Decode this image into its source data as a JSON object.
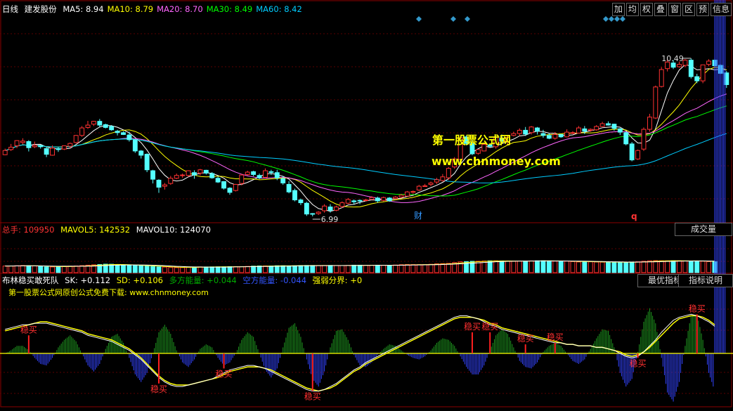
{
  "header": {
    "period": "日线",
    "stock": "建发股份",
    "ma": [
      {
        "label": "MA5: 8.94",
        "color": "#ffffff"
      },
      {
        "label": "MA10: 8.79",
        "color": "#ffff00"
      },
      {
        "label": "MA20: 8.70",
        "color": "#ff66ff"
      },
      {
        "label": "MA30: 8.49",
        "color": "#00ff00"
      },
      {
        "label": "MA60: 8.42",
        "color": "#00ccff"
      }
    ]
  },
  "toolbar": [
    "加",
    "均",
    "权",
    "叠",
    "窗",
    "区",
    "预",
    "信息"
  ],
  "volume_header": {
    "total": {
      "label": "总手: 109950",
      "color": "#ff3333"
    },
    "mavol5": {
      "label": "MAVOL5: 142532",
      "color": "#ffff00"
    },
    "mavol10": {
      "label": "MAVOL10: 124070",
      "color": "#ffffff"
    }
  },
  "volume_button": "成交量",
  "indicator_header": {
    "name": {
      "label": "布林稳买敢死队",
      "color": "#ffffff"
    },
    "sk": {
      "label": "SK: +0.112",
      "color": "#ffffff"
    },
    "sd": {
      "label": "SD: +0.106",
      "color": "#ffff00"
    },
    "long": {
      "label": "多方能量: +0.044",
      "color": "#00aa00"
    },
    "short": {
      "label": "空方能量: -0.044",
      "color": "#3355ff"
    },
    "split": {
      "label": "强弱分界: +0",
      "color": "#ffff00"
    }
  },
  "indicator_buttons": [
    "最优指标",
    "指标说明"
  ],
  "indicator_note": "第一股票公式网原创公式免费下载: www.chnmoney.com",
  "watermark": {
    "title": "第一股票公式网",
    "url": "www.chnmoney.com"
  },
  "chart_data": {
    "type": "candlestick",
    "price_range": [
      6.5,
      10.8
    ],
    "annotations": {
      "high": "10.49",
      "low": "6.99",
      "cai": "财",
      "q": "q"
    },
    "candles": [
      [
        7.84,
        7.93,
        7.97,
        7.83
      ],
      [
        7.95,
        8.0,
        8.07,
        7.92
      ],
      [
        8.03,
        8.14,
        8.15,
        7.98
      ],
      [
        8.1,
        8.13,
        8.19,
        8.06
      ],
      [
        8.12,
        7.99,
        8.15,
        7.91
      ],
      [
        8.01,
        8.04,
        8.12,
        7.98
      ],
      [
        8.04,
        8.01,
        8.05,
        7.97
      ],
      [
        7.97,
        7.85,
        8.0,
        7.79
      ],
      [
        7.83,
        7.98,
        8.04,
        7.82
      ],
      [
        7.97,
        7.95,
        8.01,
        7.9
      ],
      [
        7.96,
        8.03,
        8.04,
        7.94
      ],
      [
        8.02,
        8.08,
        8.1,
        7.98
      ],
      [
        8.1,
        8.25,
        8.26,
        8.08
      ],
      [
        8.25,
        8.41,
        8.45,
        8.22
      ],
      [
        8.42,
        8.47,
        8.56,
        8.39
      ],
      [
        8.49,
        8.55,
        8.56,
        8.45
      ],
      [
        8.55,
        8.47,
        8.6,
        8.43
      ],
      [
        8.48,
        8.42,
        8.5,
        8.4
      ],
      [
        8.44,
        8.37,
        8.47,
        8.35
      ],
      [
        8.34,
        8.31,
        8.37,
        8.25
      ],
      [
        8.31,
        8.27,
        8.34,
        8.26
      ],
      [
        8.26,
        8.16,
        8.33,
        8.12
      ],
      [
        8.16,
        7.92,
        8.17,
        7.88
      ],
      [
        7.92,
        7.83,
        7.94,
        7.76
      ],
      [
        7.85,
        7.52,
        7.87,
        7.47
      ],
      [
        7.5,
        7.32,
        7.52,
        7.23
      ],
      [
        7.3,
        7.15,
        7.32,
        7.03
      ],
      [
        7.17,
        7.2,
        7.24,
        7.1
      ],
      [
        7.23,
        7.34,
        7.39,
        7.2
      ],
      [
        7.34,
        7.4,
        7.44,
        7.32
      ],
      [
        7.4,
        7.41,
        7.44,
        7.35
      ],
      [
        7.4,
        7.5,
        7.51,
        7.37
      ],
      [
        7.46,
        7.41,
        7.51,
        7.33
      ],
      [
        7.45,
        7.52,
        7.54,
        7.4
      ],
      [
        7.51,
        7.45,
        7.52,
        7.42
      ],
      [
        7.44,
        7.35,
        7.47,
        7.33
      ],
      [
        7.34,
        7.26,
        7.38,
        7.24
      ],
      [
        7.27,
        7.13,
        7.28,
        7.1
      ],
      [
        7.13,
        7.04,
        7.15,
        6.99
      ],
      [
        7.08,
        7.21,
        7.22,
        7.06
      ],
      [
        7.23,
        7.41,
        7.43,
        7.19
      ],
      [
        7.42,
        7.47,
        7.5,
        7.4
      ],
      [
        7.48,
        7.42,
        7.5,
        7.38
      ],
      [
        7.4,
        7.35,
        7.44,
        7.32
      ],
      [
        7.36,
        7.5,
        7.55,
        7.34
      ],
      [
        7.48,
        7.47,
        7.52,
        7.41
      ],
      [
        7.46,
        7.35,
        7.52,
        7.3
      ],
      [
        7.33,
        7.24,
        7.39,
        7.2
      ],
      [
        7.21,
        7.05,
        7.28,
        7.02
      ],
      [
        7.08,
        6.88,
        7.12,
        6.85
      ],
      [
        6.88,
        6.82,
        6.91,
        6.77
      ],
      [
        6.81,
        6.58,
        6.84,
        6.54
      ],
      [
        6.59,
        6.58,
        6.6,
        6.53
      ],
      [
        6.59,
        6.62,
        6.64,
        6.56
      ],
      [
        6.65,
        6.75,
        6.79,
        6.61
      ],
      [
        6.73,
        6.66,
        6.79,
        6.61
      ],
      [
        6.66,
        6.73,
        6.76,
        6.64
      ],
      [
        6.74,
        6.82,
        6.85,
        6.71
      ],
      [
        6.81,
        6.89,
        6.92,
        6.79
      ],
      [
        6.86,
        6.84,
        6.89,
        6.79
      ],
      [
        6.87,
        6.86,
        6.89,
        6.79
      ],
      [
        6.88,
        6.88,
        6.9,
        6.85
      ],
      [
        6.89,
        6.93,
        6.96,
        6.88
      ],
      [
        6.92,
        6.86,
        6.95,
        6.82
      ],
      [
        6.87,
        6.93,
        6.95,
        6.85
      ],
      [
        6.92,
        6.86,
        6.94,
        6.84
      ],
      [
        6.91,
        6.94,
        6.96,
        6.89
      ],
      [
        6.94,
        6.98,
        7.01,
        6.92
      ],
      [
        6.96,
        7.05,
        7.07,
        6.96
      ],
      [
        7.04,
        7.06,
        7.08,
        7.01
      ],
      [
        7.09,
        7.17,
        7.2,
        7.07
      ],
      [
        7.17,
        7.18,
        7.22,
        7.16
      ],
      [
        7.21,
        7.24,
        7.27,
        7.17
      ],
      [
        7.26,
        7.31,
        7.35,
        7.22
      ],
      [
        7.29,
        7.37,
        7.43,
        7.27
      ],
      [
        7.35,
        7.55,
        7.58,
        7.31
      ],
      [
        7.58,
        7.75,
        7.79,
        7.54
      ],
      [
        7.74,
        8.2,
        8.23,
        7.72
      ],
      [
        8.22,
        8.08,
        8.25,
        8.04
      ],
      [
        8.08,
        7.86,
        8.14,
        7.83
      ],
      [
        7.87,
        7.95,
        7.95,
        7.84
      ],
      [
        7.92,
        8.06,
        8.1,
        7.91
      ],
      [
        8.05,
        8.02,
        8.06,
        8.0
      ],
      [
        8.01,
        8.21,
        8.22,
        7.97
      ],
      [
        8.19,
        8.13,
        8.27,
        8.07
      ],
      [
        8.12,
        8.21,
        8.26,
        8.06
      ],
      [
        8.25,
        8.29,
        8.33,
        8.23
      ],
      [
        8.29,
        8.36,
        8.4,
        8.24
      ],
      [
        8.36,
        8.28,
        8.43,
        8.24
      ],
      [
        8.31,
        8.43,
        8.45,
        8.27
      ],
      [
        8.41,
        8.34,
        8.43,
        8.27
      ],
      [
        8.29,
        8.25,
        8.37,
        8.2
      ],
      [
        8.25,
        8.19,
        8.3,
        8.17
      ],
      [
        8.19,
        8.27,
        8.32,
        8.16
      ],
      [
        8.27,
        8.22,
        8.28,
        8.2
      ],
      [
        8.22,
        8.32,
        8.38,
        8.21
      ],
      [
        8.31,
        8.31,
        8.34,
        8.28
      ],
      [
        8.3,
        8.41,
        8.45,
        8.29
      ],
      [
        8.39,
        8.34,
        8.45,
        8.28
      ],
      [
        8.36,
        8.38,
        8.4,
        8.33
      ],
      [
        8.37,
        8.44,
        8.47,
        8.35
      ],
      [
        8.44,
        8.5,
        8.54,
        8.43
      ],
      [
        8.5,
        8.47,
        8.55,
        8.46
      ],
      [
        8.49,
        8.4,
        8.5,
        8.35
      ],
      [
        8.39,
        8.32,
        8.41,
        8.26
      ],
      [
        8.31,
        8.07,
        8.33,
        8.04
      ],
      [
        8.07,
        7.73,
        8.11,
        7.7
      ],
      [
        7.75,
        7.93,
        7.95,
        7.73
      ],
      [
        7.96,
        8.38,
        8.42,
        7.92
      ],
      [
        8.38,
        8.64,
        8.71,
        8.33
      ],
      [
        8.62,
        9.28,
        9.31,
        8.6
      ],
      [
        9.29,
        9.65,
        9.7,
        9.27
      ],
      [
        9.67,
        9.81,
        9.87,
        9.61
      ],
      [
        9.79,
        9.7,
        9.85,
        9.66
      ],
      [
        9.71,
        9.76,
        9.82,
        9.69
      ],
      [
        9.74,
        9.85,
        9.87,
        9.7
      ],
      [
        9.85,
        9.5,
        9.89,
        9.46
      ],
      [
        9.5,
        9.41,
        9.56,
        9.36
      ],
      [
        9.41,
        9.75,
        9.75,
        9.36
      ],
      [
        9.76,
        9.83,
        9.87,
        9.72
      ],
      [
        9.85,
        9.73,
        9.89,
        9.71
      ],
      [
        9.74,
        9.57,
        9.77,
        9.55
      ],
      [
        9.58,
        9.33,
        9.62,
        9.26
      ]
    ],
    "volume_range": [
      0,
      520000
    ],
    "volume": [
      97000,
      98000,
      102000,
      105000,
      103000,
      99000,
      91000,
      84000,
      84000,
      90000,
      95000,
      96000,
      98000,
      103000,
      110000,
      115000,
      120000,
      125000,
      124000,
      118000,
      111000,
      107000,
      104000,
      101000,
      97000,
      91000,
      86000,
      82000,
      76000,
      74000,
      75000,
      78000,
      83000,
      85000,
      84000,
      85000,
      86000,
      86000,
      89000,
      89000,
      88000,
      92000,
      96000,
      99000,
      99000,
      98000,
      102000,
      102000,
      100000,
      102000,
      105000,
      106000,
      106000,
      105000,
      106000,
      106000,
      105000,
      104000,
      106000,
      110000,
      110000,
      108000,
      109000,
      110000,
      107000,
      108000,
      112000,
      117000,
      119000,
      119000,
      118000,
      119000,
      123000,
      130000,
      133000,
      137000,
      148000,
      159000,
      163000,
      167000,
      168000,
      171000,
      174000,
      175000,
      173000,
      169000,
      168000,
      170000,
      172000,
      173000,
      175000,
      176000,
      173000,
      169000,
      169000,
      169000,
      163000,
      158000,
      160000,
      160000,
      157000,
      155000,
      154000,
      154000,
      152000,
      153000,
      157000,
      160000,
      168000,
      175000,
      177000,
      175000,
      174000,
      176000,
      175000,
      172000,
      169000,
      171000,
      168000,
      163000,
      162000
    ],
    "osc_range": [
      -0.35,
      0.35
    ],
    "sk": [
      0.16,
      0.17,
      0.18,
      0.19,
      0.19,
      0.2,
      0.2,
      0.2,
      0.19,
      0.18,
      0.17,
      0.16,
      0.15,
      0.14,
      0.12,
      0.11,
      0.1,
      0.09,
      0.08,
      0.06,
      0.04,
      0.02,
      -0.01,
      -0.04,
      -0.08,
      -0.12,
      -0.16,
      -0.19,
      -0.21,
      -0.22,
      -0.22,
      -0.21,
      -0.2,
      -0.19,
      -0.18,
      -0.17,
      -0.15,
      -0.13,
      -0.11,
      -0.1,
      -0.09,
      -0.08,
      -0.08,
      -0.09,
      -0.1,
      -0.12,
      -0.14,
      -0.16,
      -0.18,
      -0.2,
      -0.22,
      -0.24,
      -0.25,
      -0.25,
      -0.24,
      -0.22,
      -0.2,
      -0.17,
      -0.14,
      -0.11,
      -0.09,
      -0.06,
      -0.04,
      -0.02,
      0.0,
      0.02,
      0.04,
      0.06,
      0.08,
      0.1,
      0.12,
      0.14,
      0.16,
      0.18,
      0.2,
      0.22,
      0.24,
      0.25,
      0.25,
      0.24,
      0.23,
      0.21,
      0.19,
      0.18,
      0.16,
      0.15,
      0.14,
      0.13,
      0.12,
      0.11,
      0.1,
      0.09,
      0.08,
      0.07,
      0.07,
      0.06,
      0.06,
      0.05,
      0.05,
      0.05,
      0.04,
      0.04,
      0.03,
      0.02,
      0.0,
      -0.02,
      -0.03,
      -0.02,
      0.01,
      0.05,
      0.09,
      0.14,
      0.18,
      0.22,
      0.24,
      0.25,
      0.26,
      0.25,
      0.23,
      0.21,
      0.18
    ],
    "sd": [
      0.15,
      0.16,
      0.17,
      0.18,
      0.19,
      0.2,
      0.21,
      0.21,
      0.2,
      0.19,
      0.18,
      0.17,
      0.16,
      0.15,
      0.13,
      0.12,
      0.11,
      0.1,
      0.09,
      0.07,
      0.05,
      0.03,
      0.0,
      -0.03,
      -0.07,
      -0.11,
      -0.15,
      -0.18,
      -0.2,
      -0.21,
      -0.21,
      -0.21,
      -0.2,
      -0.19,
      -0.18,
      -0.17,
      -0.16,
      -0.14,
      -0.12,
      -0.11,
      -0.1,
      -0.09,
      -0.09,
      -0.09,
      -0.1,
      -0.11,
      -0.13,
      -0.15,
      -0.17,
      -0.19,
      -0.21,
      -0.23,
      -0.24,
      -0.25,
      -0.24,
      -0.23,
      -0.21,
      -0.18,
      -0.15,
      -0.12,
      -0.1,
      -0.07,
      -0.05,
      -0.03,
      -0.01,
      0.01,
      0.03,
      0.05,
      0.07,
      0.09,
      0.11,
      0.13,
      0.15,
      0.17,
      0.19,
      0.21,
      0.23,
      0.24,
      0.24,
      0.24,
      0.23,
      0.22,
      0.2,
      0.19,
      0.17,
      0.16,
      0.15,
      0.14,
      0.13,
      0.12,
      0.11,
      0.1,
      0.09,
      0.08,
      0.07,
      0.06,
      0.06,
      0.05,
      0.05,
      0.05,
      0.04,
      0.04,
      0.03,
      0.02,
      0.01,
      -0.01,
      -0.02,
      -0.01,
      0.01,
      0.04,
      0.08,
      0.12,
      0.16,
      0.2,
      0.23,
      0.24,
      0.25,
      0.25,
      0.24,
      0.22,
      0.19
    ],
    "bars": [
      0.0,
      0.02,
      0.05,
      0.05,
      0.02,
      -0.03,
      -0.07,
      -0.08,
      -0.03,
      0.04,
      0.09,
      0.12,
      0.08,
      0.0,
      -0.08,
      -0.12,
      -0.07,
      0.03,
      0.11,
      0.13,
      0.07,
      -0.03,
      -0.14,
      -0.19,
      -0.13,
      -0.0,
      0.14,
      0.19,
      0.13,
      0.02,
      -0.06,
      -0.09,
      -0.04,
      0.03,
      0.06,
      0.04,
      -0.03,
      -0.08,
      -0.06,
      0.0,
      0.09,
      0.14,
      0.11,
      0.0,
      -0.11,
      -0.16,
      -0.1,
      0.04,
      0.17,
      0.2,
      0.11,
      -0.04,
      -0.17,
      -0.22,
      -0.12,
      0.04,
      0.15,
      0.16,
      0.09,
      -0.01,
      -0.08,
      -0.09,
      -0.06,
      -0.01,
      0.03,
      0.06,
      0.05,
      0.02,
      -0.01,
      -0.03,
      -0.04,
      -0.02,
      0.02,
      0.07,
      0.1,
      0.09,
      0.05,
      -0.02,
      -0.09,
      -0.14,
      -0.14,
      -0.08,
      0.02,
      0.12,
      0.16,
      0.13,
      0.04,
      -0.05,
      -0.09,
      -0.1,
      -0.06,
      0.01,
      0.05,
      0.07,
      0.05,
      0.0,
      -0.05,
      -0.07,
      -0.04,
      0.03,
      0.1,
      0.16,
      0.15,
      0.04,
      -0.13,
      -0.22,
      -0.17,
      0.01,
      0.21,
      0.3,
      0.2,
      -0.03,
      -0.26,
      -0.32,
      -0.19,
      0.05,
      0.25,
      0.26,
      0.09,
      -0.13,
      -0.25
    ],
    "buy_signals": [
      {
        "i": 4,
        "v": 0.12,
        "label": "稳买"
      },
      {
        "i": 26,
        "v": -0.2,
        "label": "稳买"
      },
      {
        "i": 37,
        "v": -0.1,
        "label": "稳买"
      },
      {
        "i": 52,
        "v": -0.25,
        "label": "稳买"
      },
      {
        "i": 79,
        "v": 0.14,
        "label": "稳买"
      },
      {
        "i": 82,
        "v": 0.14,
        "label": "稳买"
      },
      {
        "i": 88,
        "v": 0.06,
        "label": "稳买"
      },
      {
        "i": 93,
        "v": 0.07,
        "label": "稳买"
      },
      {
        "i": 107,
        "v": -0.03,
        "label": "稳买"
      },
      {
        "i": 117,
        "v": 0.26,
        "label": "稳买"
      }
    ]
  }
}
